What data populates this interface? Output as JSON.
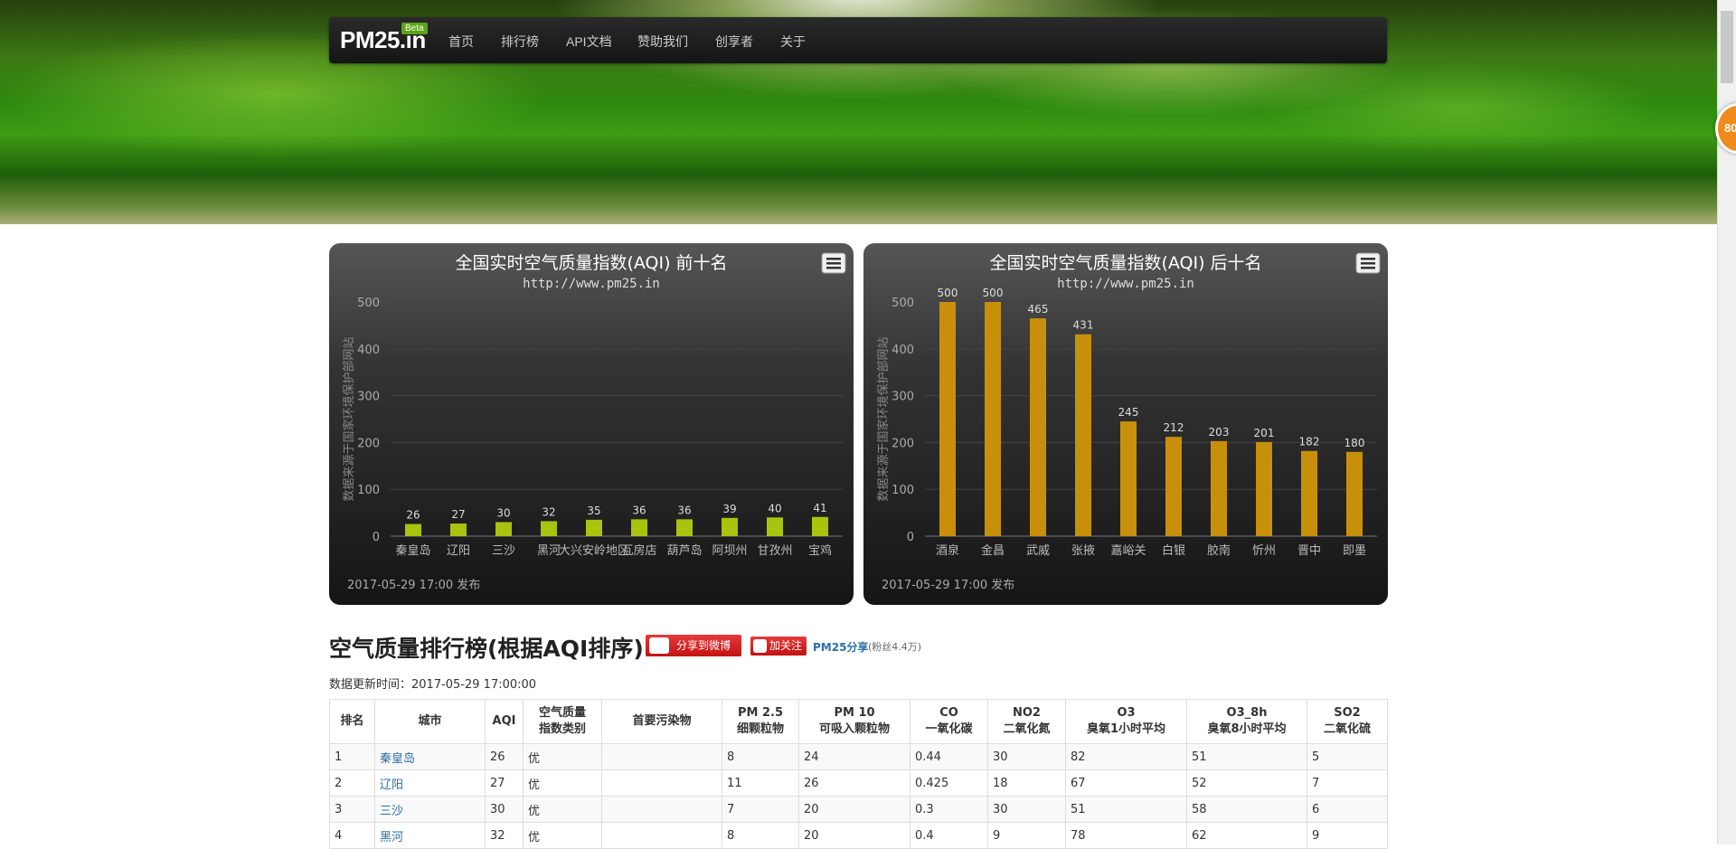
{
  "nav": {
    "brand": "PM25.in",
    "beta": "Beta",
    "items": [
      "首页",
      "排行榜",
      "API文档",
      "赞助我们",
      "创享者",
      "关于"
    ]
  },
  "float_badge": "80",
  "chart_data": [
    {
      "type": "bar",
      "title": "全国实时空气质量指数(AQI) 前十名",
      "subtitle": "http://www.pm25.in",
      "ylabel": "数据来源于国家环境保护部网站",
      "ylim": [
        0,
        500
      ],
      "yticks": [
        0,
        100,
        200,
        300,
        400,
        500
      ],
      "categories": [
        "秦皇岛",
        "辽阳",
        "三沙",
        "黑河",
        "大兴安岭地区",
        "瓦房店",
        "葫芦岛",
        "阿坝州",
        "甘孜州",
        "宝鸡"
      ],
      "values": [
        26,
        27,
        30,
        32,
        35,
        36,
        36,
        39,
        40,
        41
      ],
      "color": "#a8c40e",
      "footer": "2017-05-29 17:00 发布"
    },
    {
      "type": "bar",
      "title": "全国实时空气质量指数(AQI) 后十名",
      "subtitle": "http://www.pm25.in",
      "ylabel": "数据来源于国家环境保护部网站",
      "ylim": [
        0,
        500
      ],
      "yticks": [
        0,
        100,
        200,
        300,
        400,
        500
      ],
      "categories": [
        "酒泉",
        "金昌",
        "武威",
        "张掖",
        "嘉峪关",
        "白银",
        "胶南",
        "忻州",
        "晋中",
        "即墨"
      ],
      "values": [
        500,
        500,
        465,
        431,
        245,
        212,
        203,
        201,
        182,
        180
      ],
      "color": "#c8900a",
      "footer": "2017-05-29 17:00 发布"
    }
  ],
  "ranking": {
    "title": "空气质量排行榜(根据AQI排序)",
    "share_label": "分享到微博",
    "follow_label": "加关注",
    "follow_name": "PM25分享",
    "follow_count": "(粉丝4.4万)",
    "update_time": "数据更新时间：2017-05-29 17:00:00"
  },
  "table": {
    "headers": [
      [
        "排名"
      ],
      [
        "城市"
      ],
      [
        "AQI"
      ],
      [
        "空气质量",
        "指数类别"
      ],
      [
        "首要污染物"
      ],
      [
        "PM 2.5",
        "细颗粒物"
      ],
      [
        "PM 10",
        "可吸入颗粒物"
      ],
      [
        "CO",
        "一氧化碳"
      ],
      [
        "NO2",
        "二氧化氮"
      ],
      [
        "O3",
        "臭氧1小时平均"
      ],
      [
        "O3_8h",
        "臭氧8小时平均"
      ],
      [
        "SO2",
        "二氧化硫"
      ]
    ],
    "rows": [
      [
        "1",
        "秦皇岛",
        "26",
        "优",
        "",
        "8",
        "24",
        "0.44",
        "30",
        "82",
        "51",
        "5"
      ],
      [
        "2",
        "辽阳",
        "27",
        "优",
        "",
        "11",
        "26",
        "0.425",
        "18",
        "67",
        "52",
        "7"
      ],
      [
        "3",
        "三沙",
        "30",
        "优",
        "",
        "7",
        "20",
        "0.3",
        "30",
        "51",
        "58",
        "6"
      ],
      [
        "4",
        "黑河",
        "32",
        "优",
        "",
        "8",
        "20",
        "0.4",
        "9",
        "78",
        "62",
        "9"
      ]
    ]
  }
}
